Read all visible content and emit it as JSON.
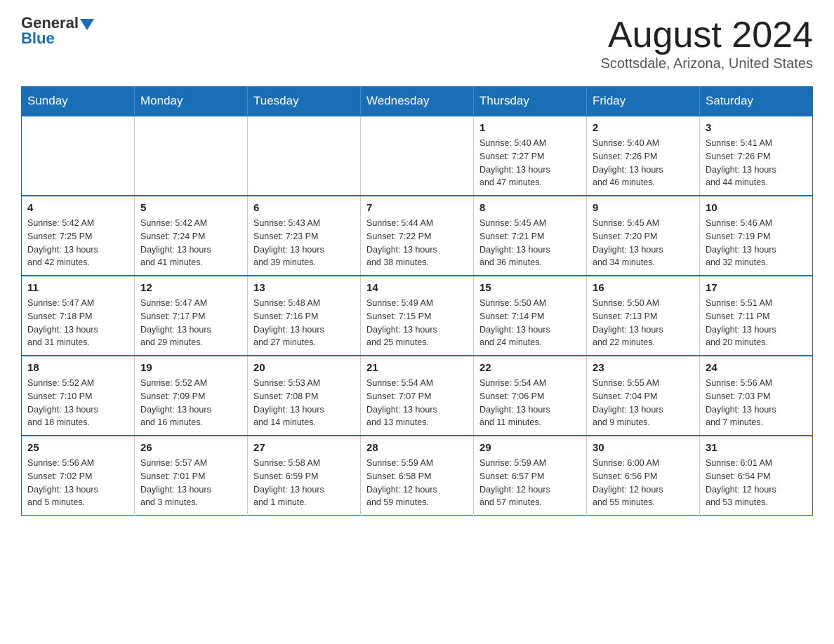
{
  "logo": {
    "general": "General",
    "blue": "Blue"
  },
  "header": {
    "month": "August 2024",
    "location": "Scottsdale, Arizona, United States"
  },
  "weekdays": [
    "Sunday",
    "Monday",
    "Tuesday",
    "Wednesday",
    "Thursday",
    "Friday",
    "Saturday"
  ],
  "weeks": [
    [
      {
        "day": "",
        "info": ""
      },
      {
        "day": "",
        "info": ""
      },
      {
        "day": "",
        "info": ""
      },
      {
        "day": "",
        "info": ""
      },
      {
        "day": "1",
        "info": "Sunrise: 5:40 AM\nSunset: 7:27 PM\nDaylight: 13 hours\nand 47 minutes."
      },
      {
        "day": "2",
        "info": "Sunrise: 5:40 AM\nSunset: 7:26 PM\nDaylight: 13 hours\nand 46 minutes."
      },
      {
        "day": "3",
        "info": "Sunrise: 5:41 AM\nSunset: 7:26 PM\nDaylight: 13 hours\nand 44 minutes."
      }
    ],
    [
      {
        "day": "4",
        "info": "Sunrise: 5:42 AM\nSunset: 7:25 PM\nDaylight: 13 hours\nand 42 minutes."
      },
      {
        "day": "5",
        "info": "Sunrise: 5:42 AM\nSunset: 7:24 PM\nDaylight: 13 hours\nand 41 minutes."
      },
      {
        "day": "6",
        "info": "Sunrise: 5:43 AM\nSunset: 7:23 PM\nDaylight: 13 hours\nand 39 minutes."
      },
      {
        "day": "7",
        "info": "Sunrise: 5:44 AM\nSunset: 7:22 PM\nDaylight: 13 hours\nand 38 minutes."
      },
      {
        "day": "8",
        "info": "Sunrise: 5:45 AM\nSunset: 7:21 PM\nDaylight: 13 hours\nand 36 minutes."
      },
      {
        "day": "9",
        "info": "Sunrise: 5:45 AM\nSunset: 7:20 PM\nDaylight: 13 hours\nand 34 minutes."
      },
      {
        "day": "10",
        "info": "Sunrise: 5:46 AM\nSunset: 7:19 PM\nDaylight: 13 hours\nand 32 minutes."
      }
    ],
    [
      {
        "day": "11",
        "info": "Sunrise: 5:47 AM\nSunset: 7:18 PM\nDaylight: 13 hours\nand 31 minutes."
      },
      {
        "day": "12",
        "info": "Sunrise: 5:47 AM\nSunset: 7:17 PM\nDaylight: 13 hours\nand 29 minutes."
      },
      {
        "day": "13",
        "info": "Sunrise: 5:48 AM\nSunset: 7:16 PM\nDaylight: 13 hours\nand 27 minutes."
      },
      {
        "day": "14",
        "info": "Sunrise: 5:49 AM\nSunset: 7:15 PM\nDaylight: 13 hours\nand 25 minutes."
      },
      {
        "day": "15",
        "info": "Sunrise: 5:50 AM\nSunset: 7:14 PM\nDaylight: 13 hours\nand 24 minutes."
      },
      {
        "day": "16",
        "info": "Sunrise: 5:50 AM\nSunset: 7:13 PM\nDaylight: 13 hours\nand 22 minutes."
      },
      {
        "day": "17",
        "info": "Sunrise: 5:51 AM\nSunset: 7:11 PM\nDaylight: 13 hours\nand 20 minutes."
      }
    ],
    [
      {
        "day": "18",
        "info": "Sunrise: 5:52 AM\nSunset: 7:10 PM\nDaylight: 13 hours\nand 18 minutes."
      },
      {
        "day": "19",
        "info": "Sunrise: 5:52 AM\nSunset: 7:09 PM\nDaylight: 13 hours\nand 16 minutes."
      },
      {
        "day": "20",
        "info": "Sunrise: 5:53 AM\nSunset: 7:08 PM\nDaylight: 13 hours\nand 14 minutes."
      },
      {
        "day": "21",
        "info": "Sunrise: 5:54 AM\nSunset: 7:07 PM\nDaylight: 13 hours\nand 13 minutes."
      },
      {
        "day": "22",
        "info": "Sunrise: 5:54 AM\nSunset: 7:06 PM\nDaylight: 13 hours\nand 11 minutes."
      },
      {
        "day": "23",
        "info": "Sunrise: 5:55 AM\nSunset: 7:04 PM\nDaylight: 13 hours\nand 9 minutes."
      },
      {
        "day": "24",
        "info": "Sunrise: 5:56 AM\nSunset: 7:03 PM\nDaylight: 13 hours\nand 7 minutes."
      }
    ],
    [
      {
        "day": "25",
        "info": "Sunrise: 5:56 AM\nSunset: 7:02 PM\nDaylight: 13 hours\nand 5 minutes."
      },
      {
        "day": "26",
        "info": "Sunrise: 5:57 AM\nSunset: 7:01 PM\nDaylight: 13 hours\nand 3 minutes."
      },
      {
        "day": "27",
        "info": "Sunrise: 5:58 AM\nSunset: 6:59 PM\nDaylight: 13 hours\nand 1 minute."
      },
      {
        "day": "28",
        "info": "Sunrise: 5:59 AM\nSunset: 6:58 PM\nDaylight: 12 hours\nand 59 minutes."
      },
      {
        "day": "29",
        "info": "Sunrise: 5:59 AM\nSunset: 6:57 PM\nDaylight: 12 hours\nand 57 minutes."
      },
      {
        "day": "30",
        "info": "Sunrise: 6:00 AM\nSunset: 6:56 PM\nDaylight: 12 hours\nand 55 minutes."
      },
      {
        "day": "31",
        "info": "Sunrise: 6:01 AM\nSunset: 6:54 PM\nDaylight: 12 hours\nand 53 minutes."
      }
    ]
  ]
}
